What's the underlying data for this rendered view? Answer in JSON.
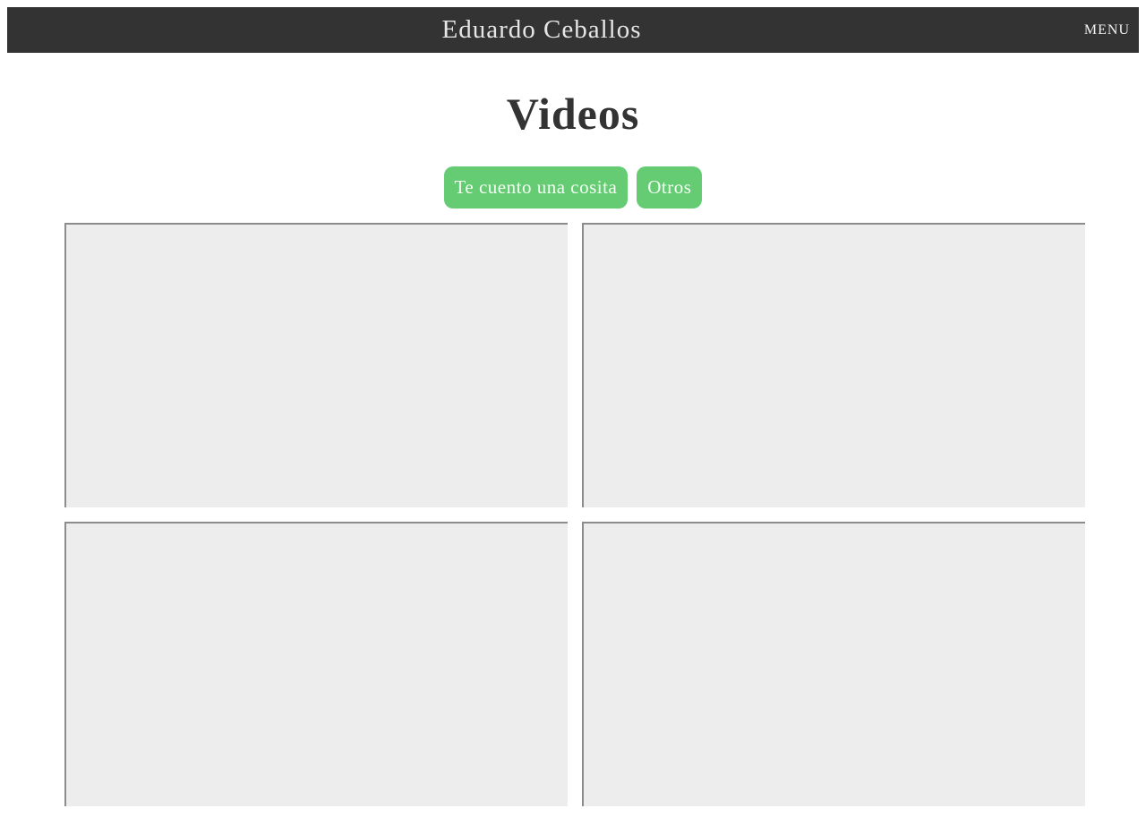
{
  "header": {
    "site_title": "Eduardo Ceballos",
    "menu_label": "MENU"
  },
  "main": {
    "heading": "Videos",
    "filters": [
      {
        "label": "Te cuento una cosita"
      },
      {
        "label": "Otros"
      }
    ]
  },
  "colors": {
    "topbar_bg": "#333333",
    "filter_bg": "#66cc73",
    "video_placeholder_bg": "#ededed",
    "heading_text": "#333333"
  }
}
